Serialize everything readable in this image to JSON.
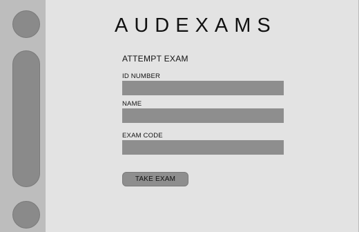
{
  "app": {
    "brand": "AUDEXAMS"
  },
  "form": {
    "title": "ATTEMPT EXAM",
    "fields": [
      {
        "label": "ID NUMBER",
        "value": "",
        "placeholder": ""
      },
      {
        "label": "NAME",
        "value": "",
        "placeholder": ""
      },
      {
        "label": "EXAM CODE",
        "value": "",
        "placeholder": ""
      }
    ],
    "submit_label": "TAKE EXAM"
  },
  "colors": {
    "background": "#e3e3e3",
    "rail": "#bdbdbd",
    "control": "#8e8e8e",
    "text": "#111111"
  }
}
